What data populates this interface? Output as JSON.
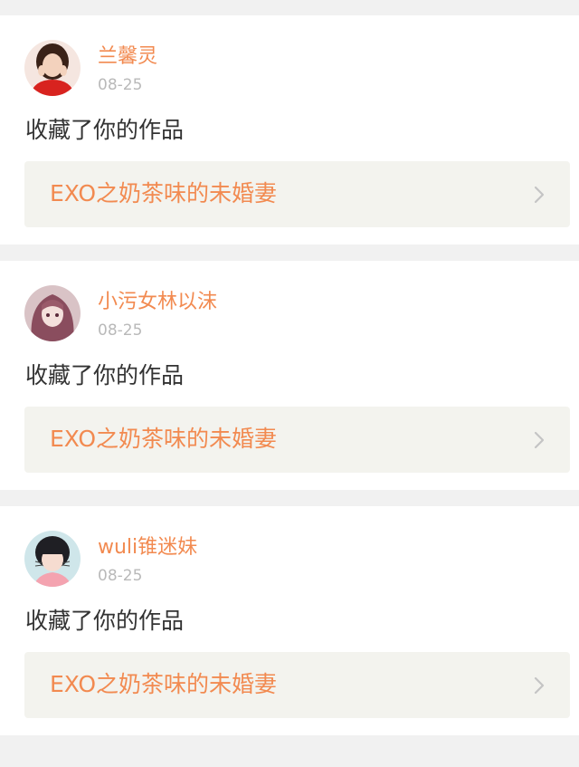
{
  "notifications": [
    {
      "username": "兰馨灵",
      "date": "08-25",
      "action": "收藏了你的作品",
      "work_title": "EXO之奶茶味的未婚妻",
      "avatar_icon": "avatar-woman-red-outfit"
    },
    {
      "username": "小污女林以沫",
      "date": "08-25",
      "action": "收藏了你的作品",
      "work_title": "EXO之奶茶味的未婚妻",
      "avatar_icon": "avatar-anime-girl"
    },
    {
      "username": "wuli锥迷妹",
      "date": "08-25",
      "action": "收藏了你的作品",
      "work_title": "EXO之奶茶味的未婚妻",
      "avatar_icon": "avatar-girl-cat-whiskers"
    }
  ],
  "colors": {
    "accent": "#f28a50",
    "date_gray": "#b9b9b9",
    "text_dark": "#333333",
    "link_bg": "#f3f3ee",
    "page_bg": "#f1f1f1"
  }
}
